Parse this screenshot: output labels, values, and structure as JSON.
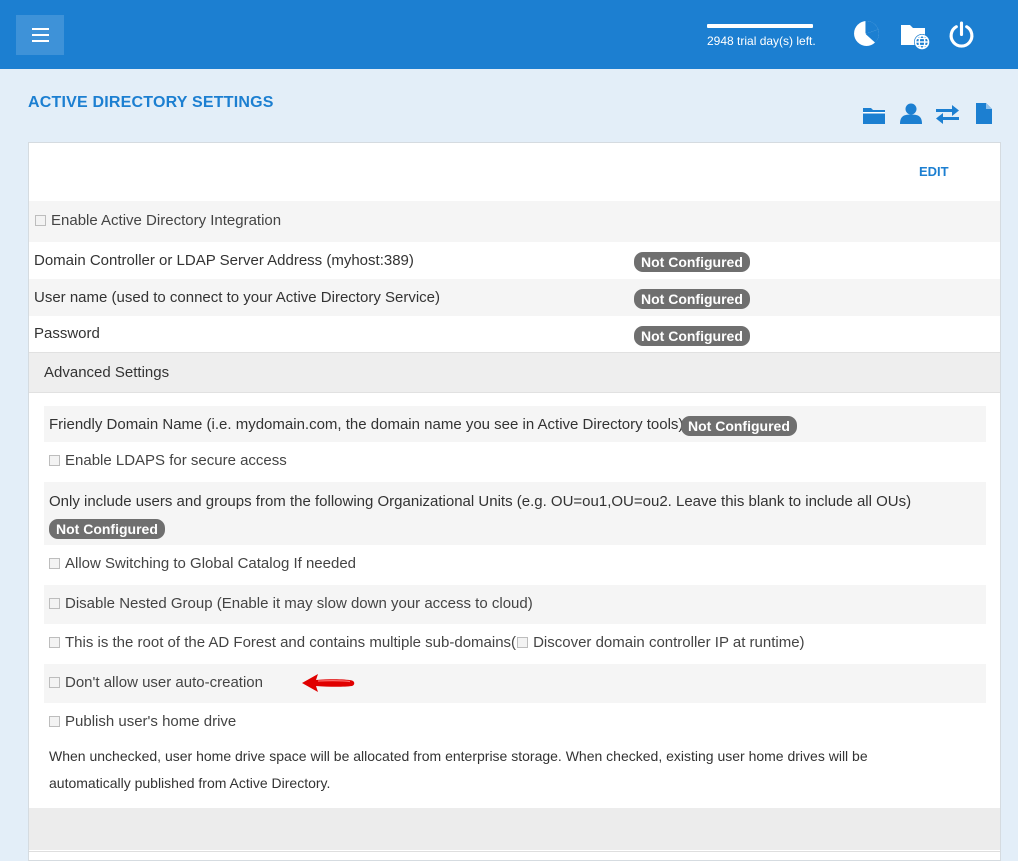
{
  "header": {
    "trial_text": "2948 trial day(s) left."
  },
  "page": {
    "title": "ACTIVE DIRECTORY SETTINGS",
    "edit_label": "EDIT"
  },
  "settings": {
    "enable_ad": "Enable Active Directory Integration",
    "dc_label": "Domain Controller or LDAP Server Address (myhost:389)",
    "user_label": "User name (used to connect to your Active Directory Service)",
    "password_label": "Password",
    "status_not_configured": "Not Configured"
  },
  "advanced": {
    "title": "Advanced Settings",
    "friendly_domain": "Friendly Domain Name (i.e. mydomain.com, the domain name you see in Active Directory tools)",
    "ldaps": "Enable LDAPS for secure access",
    "ou_filter": "Only include users and groups from the following Organizational Units (e.g. OU=ou1,OU=ou2. Leave this blank to include all OUs)",
    "global_catalog": "Allow Switching to Global Catalog If needed",
    "nested_group": "Disable Nested Group (Enable it may slow down your access to cloud)",
    "forest_root": "This is the root of the AD Forest and contains multiple sub-domains(",
    "discover_dc": "Discover domain controller IP at runtime)",
    "no_auto_create": "Don't allow user auto-creation",
    "publish_home": "Publish user's home drive",
    "publish_desc_1": "When unchecked, user home drive space will be allocated from enterprise storage. When checked, existing user home drives will be",
    "publish_desc_2": "automatically published from Active Directory."
  },
  "icons": {
    "menu": "hamburger-menu-icon",
    "dashboard": "pie-chart-icon",
    "web_folder": "folder-globe-icon",
    "power": "power-icon",
    "folder": "folder-icon",
    "user": "user-icon",
    "sync": "arrows-exchange-icon",
    "file": "file-icon",
    "annotation": "red-arrow-icon"
  },
  "colors": {
    "primary": "#1c7fd1",
    "badge": "#6f6f6f",
    "annotation": "#e00000"
  }
}
